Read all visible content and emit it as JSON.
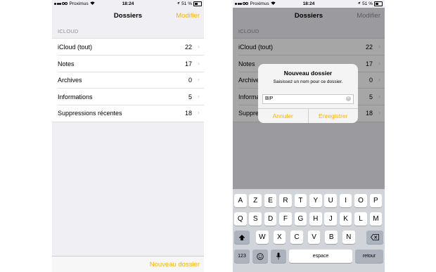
{
  "left": {
    "statusbar": {
      "carrier": "Proximus",
      "time": "18:24",
      "battery": "51 %"
    },
    "nav": {
      "title": "Dossiers",
      "action": "Modifier"
    },
    "section": "ICLOUD",
    "rows": [
      {
        "label": "iCloud (tout)",
        "count": "22"
      },
      {
        "label": "Notes",
        "count": "17"
      },
      {
        "label": "Archives",
        "count": "0"
      },
      {
        "label": "Informations",
        "count": "5"
      },
      {
        "label": "Suppressions récentes",
        "count": "18"
      }
    ],
    "toolbar": {
      "new_folder": "Nouveau dossier"
    }
  },
  "right": {
    "statusbar": {
      "carrier": "Proximus",
      "time": "18:24",
      "battery": "51 %"
    },
    "nav": {
      "title": "Dossiers",
      "action": "Modifier"
    },
    "section": "ICLOUD",
    "rows": [
      {
        "label": "iCloud (tout)",
        "count": "22"
      },
      {
        "label": "Notes",
        "count": "17"
      },
      {
        "label": "Archives",
        "count": "0"
      },
      {
        "label": "Informations",
        "count": "5"
      },
      {
        "label": "Suppressions récentes",
        "count": "18"
      }
    ],
    "alert": {
      "title": "Nouveau dossier",
      "message": "Saisissez un nom pour ce dossier.",
      "input_value": "BIP",
      "cancel": "Annuler",
      "save": "Enregistrer"
    },
    "keyboard": {
      "row1": [
        "A",
        "Z",
        "E",
        "R",
        "T",
        "Y",
        "U",
        "I",
        "O",
        "P"
      ],
      "row2": [
        "Q",
        "S",
        "D",
        "F",
        "G",
        "H",
        "J",
        "K",
        "L",
        "M"
      ],
      "row3": [
        "W",
        "X",
        "C",
        "V",
        "B",
        "N"
      ],
      "numbers": "123",
      "space": "espace",
      "return": "retour"
    }
  },
  "colors": {
    "accent": "#f7b500",
    "background": "#efeff4",
    "keyboard": "#d1d4d9"
  }
}
